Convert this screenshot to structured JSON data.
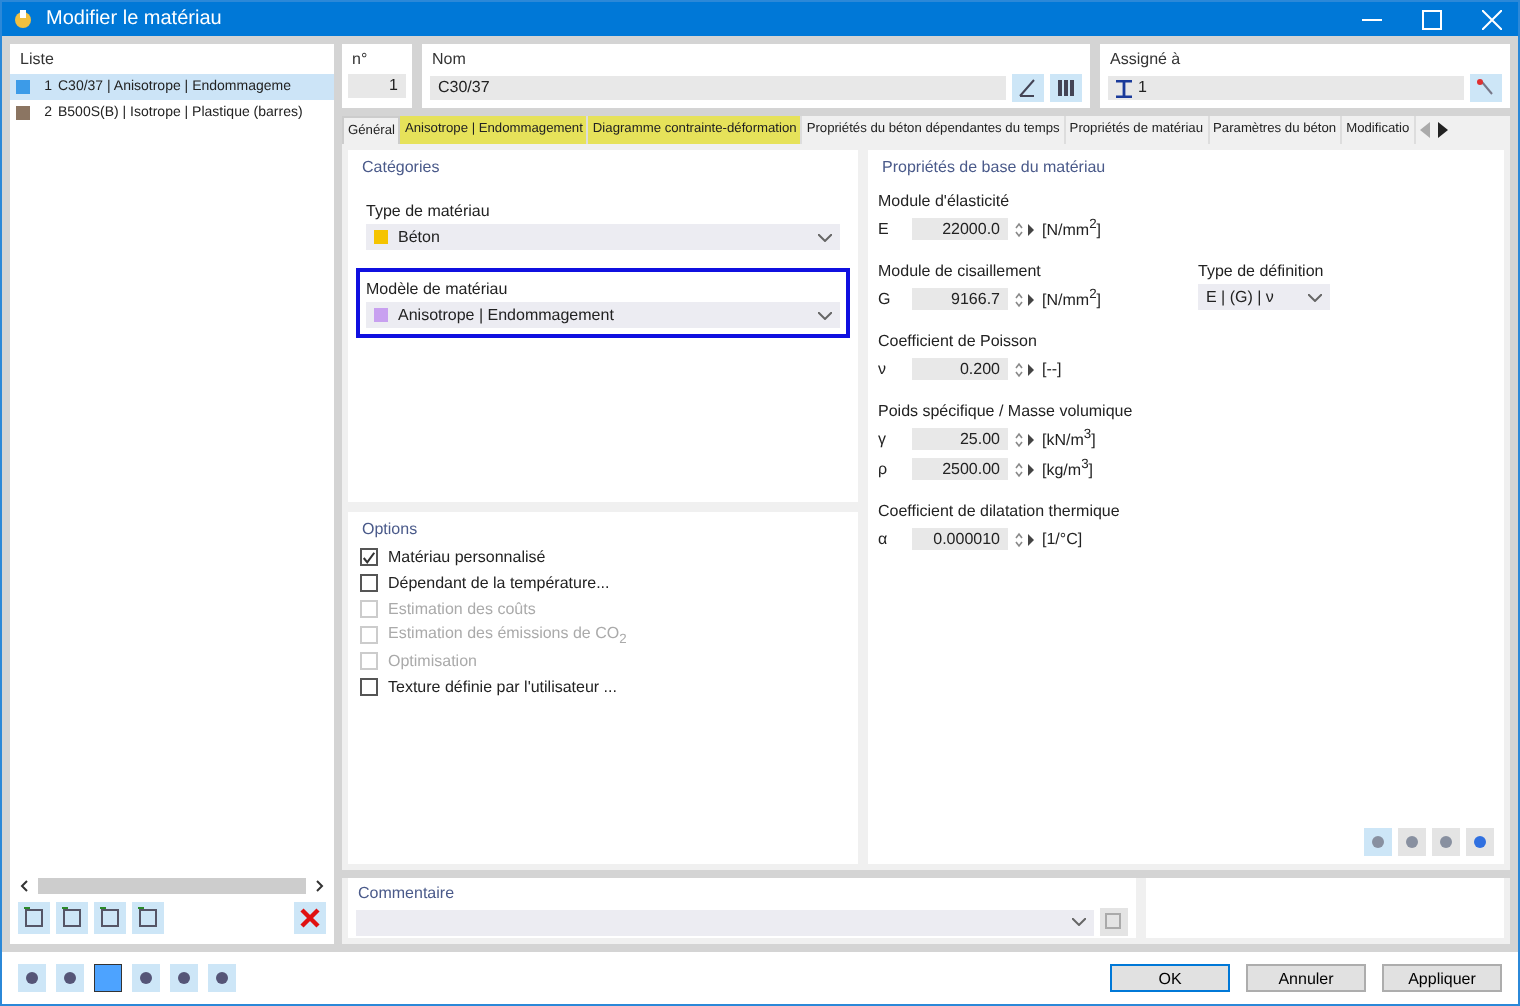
{
  "window": {
    "title": "Modifier le matériau"
  },
  "list": {
    "title": "Liste",
    "items": [
      {
        "number": "1",
        "name": "C30/37 | Anisotrope | Endommageme",
        "color": "#3c9be8",
        "selected": true
      },
      {
        "number": "2",
        "name": "B500S(B) | Isotrope | Plastique (barres)",
        "color": "#8b7562",
        "selected": false
      }
    ]
  },
  "number": {
    "label": "n°",
    "value": "1"
  },
  "name": {
    "label": "Nom",
    "value": "C30/37"
  },
  "assigned": {
    "label": "Assigné à",
    "value": "1"
  },
  "tabs": [
    {
      "label": "Général",
      "selected": true,
      "highlighted": false
    },
    {
      "label": "Anisotrope | Endommagement",
      "selected": false,
      "highlighted": true
    },
    {
      "label": "Diagramme contrainte-déformation",
      "selected": false,
      "highlighted": true
    },
    {
      "label": "Propriétés du béton dépendantes du temps",
      "selected": false,
      "highlighted": false
    },
    {
      "label": "Propriétés de matériau",
      "selected": false,
      "highlighted": false
    },
    {
      "label": "Paramètres du béton",
      "selected": false,
      "highlighted": false
    },
    {
      "label": "Modificatio",
      "selected": false,
      "highlighted": false
    }
  ],
  "categories": {
    "title": "Catégories",
    "fields": [
      {
        "label": "Type de matériau",
        "value": "Béton",
        "color": "#f5c400",
        "focused": false
      },
      {
        "label": "Modèle de matériau",
        "value": "Anisotrope | Endommagement",
        "color": "#c8a0f0",
        "focused": true
      }
    ]
  },
  "options": {
    "title": "Options",
    "items": [
      {
        "label": "Matériau personnalisé",
        "checked": true,
        "disabled": false
      },
      {
        "label": "Dépendant de la température...",
        "checked": false,
        "disabled": false
      },
      {
        "label": "Estimation des coûts",
        "checked": false,
        "disabled": true
      },
      {
        "label": "Estimation des émissions de CO$_{2}$",
        "checked": false,
        "disabled": true
      },
      {
        "label": "Optimisation",
        "checked": false,
        "disabled": true
      },
      {
        "label": "Texture définie par l'utilisateur ...",
        "checked": false,
        "disabled": false
      }
    ]
  },
  "properties": {
    "title": "Propriétés de base du matériau",
    "groups": [
      {
        "label": "Module d'élasticité",
        "rows": [
          {
            "symbol": "E",
            "value": "22000.0",
            "unit": "[N/mm$^{2}$]"
          }
        ]
      },
      {
        "label": "Module de cisaillement",
        "rows": [
          {
            "symbol": "G",
            "value": "9166.7",
            "unit": "[N/mm$^{2}$]"
          }
        ],
        "definition": {
          "label": "Type de définition",
          "value": "E | (G) | ν"
        }
      },
      {
        "label": "Coefficient de Poisson",
        "rows": [
          {
            "symbol": "ν",
            "value": "0.200",
            "unit": "[--]"
          }
        ]
      },
      {
        "label": "Poids spécifique / Masse volumique",
        "rows": [
          {
            "symbol": "γ",
            "value": "25.00",
            "unit": "[kN/m$^{3}$]"
          },
          {
            "symbol": "ρ",
            "value": "2500.00",
            "unit": "[kg/m$^{3}$]"
          }
        ]
      },
      {
        "label": "Coefficient de dilatation thermique",
        "rows": [
          {
            "symbol": "α",
            "value": "0.000010",
            "unit": "[1/°C]"
          }
        ]
      }
    ]
  },
  "comment": {
    "label": "Commentaire"
  },
  "buttons": [
    {
      "label": "OK",
      "default": true
    },
    {
      "label": "Annuler",
      "default": false
    },
    {
      "label": "Appliquer",
      "default": false
    }
  ]
}
